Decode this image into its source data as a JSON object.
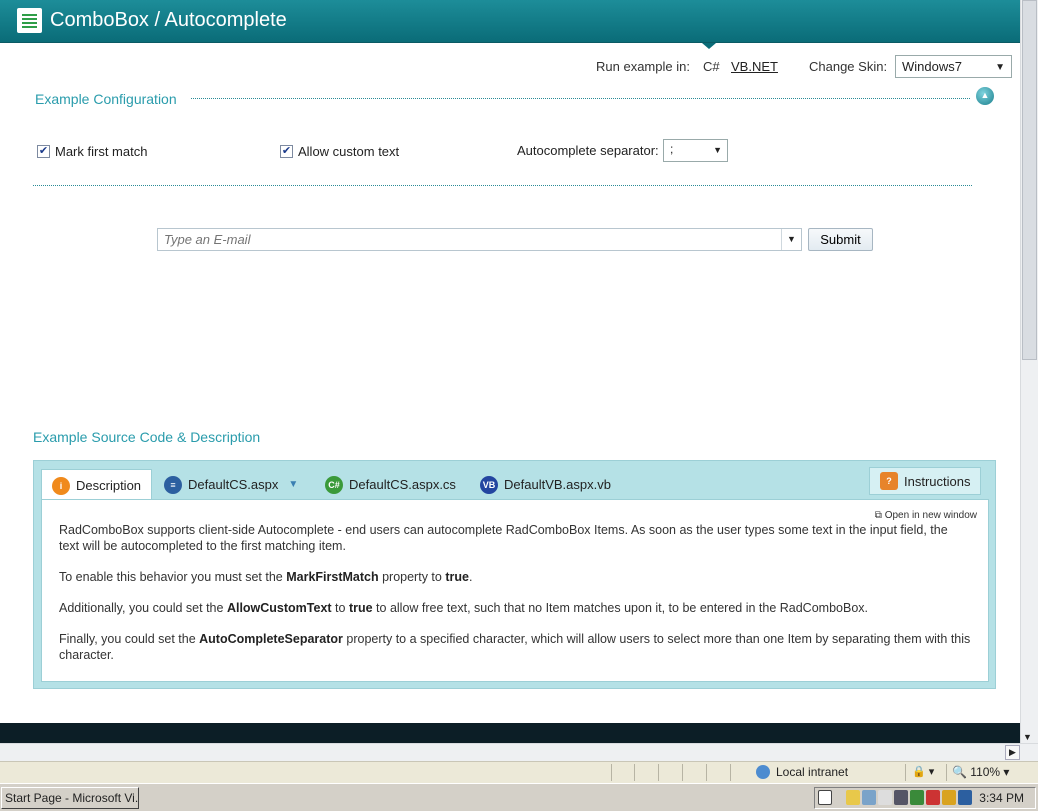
{
  "header": {
    "title": "ComboBox / Autocomplete"
  },
  "toprow": {
    "run_label": "Run example in:",
    "lang_cs": "C#",
    "lang_vb": "VB.NET",
    "skin_label": "Change Skin:",
    "skin_value": "Windows7"
  },
  "config": {
    "title": "Example Configuration",
    "mark_first_match": {
      "label": "Mark first match",
      "checked": true
    },
    "allow_custom_text": {
      "label": "Allow custom text",
      "checked": true
    },
    "separator_label": "Autocomplete separator:",
    "separator_value": ";"
  },
  "email": {
    "placeholder": "Type an E-mail",
    "submit_label": "Submit"
  },
  "source": {
    "title": "Example Source Code & Description",
    "tabs": [
      {
        "label": "Description",
        "icon": "info-icon"
      },
      {
        "label": "DefaultCS.aspx",
        "icon": "list-icon"
      },
      {
        "label": "DefaultCS.aspx.cs",
        "icon": "cs-file-icon"
      },
      {
        "label": "DefaultVB.aspx.vb",
        "icon": "vb-file-icon"
      }
    ],
    "instructions_label": "Instructions",
    "open_new_window": "Open in new window",
    "paragraphs": {
      "p1": "RadComboBox supports client-side Autocomplete - end users can autocomplete RadComboBox Items. As soon as the user types some text in the input field, the text will be autocompleted to the first matching item.",
      "p2a": "To enable this behavior you must set the ",
      "p2b": "MarkFirstMatch",
      "p2c": " property to ",
      "p2d": "true",
      "p2e": ".",
      "p3a": "Additionally, you could set the ",
      "p3b": "AllowCustomText",
      "p3c": " to ",
      "p3d": "true",
      "p3e": " to allow free text, such that no Item matches upon it, to be entered in the RadComboBox.",
      "p4a": "Finally, you could set the ",
      "p4b": "AutoCompleteSeparator",
      "p4c": " property to a specified character, which will allow users to select more than one Item by separating them with this character."
    }
  },
  "statusbar": {
    "zone": "Local intranet",
    "zoom": "110%"
  },
  "taskbar": {
    "task": "Start Page - Microsoft Vi...",
    "clock": "3:34 PM"
  },
  "colors": {
    "header": "#0a6c78",
    "accent": "#2a9cac",
    "panel": "#b5e1e6"
  }
}
